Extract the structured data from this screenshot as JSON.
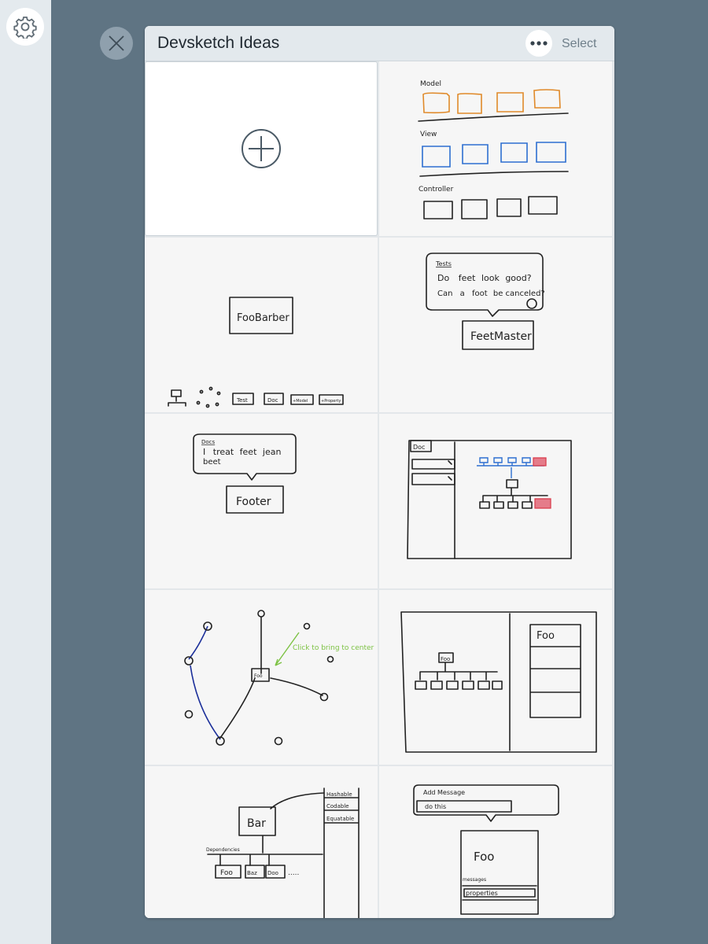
{
  "header": {
    "title": "Devsketch Ideas",
    "select_label": "Select"
  },
  "icons": {
    "settings": "gear-icon",
    "close": "close-icon",
    "more": "more-horizontal-icon",
    "add": "plus-circle-icon"
  },
  "colors": {
    "background": "#5f7483",
    "rail": "#e4eaee",
    "header": "#e3e9ed",
    "accent_blue": "#2d6fd0",
    "accent_orange": "#e08a2a",
    "accent_green": "#7cc243",
    "accent_red": "#d93a4a"
  },
  "sketches": [
    {
      "labels": [
        "Model",
        "View",
        "Controller"
      ]
    },
    {
      "labels": [
        "FooBarber",
        "Test",
        "Doc",
        "+Model",
        "+Property"
      ]
    },
    {
      "labels": [
        "Tests",
        "Do",
        "feet",
        "look",
        "good?",
        "Can",
        "a",
        "foot",
        "be canceled?",
        "FeetMaster"
      ]
    },
    {
      "labels": [
        "Docs",
        "I",
        "treat",
        "feet",
        "jean",
        "beet",
        "Footer"
      ]
    },
    {
      "labels": [
        "Doc"
      ]
    },
    {
      "labels": [
        "Foo",
        "Click to bring to center"
      ]
    },
    {
      "labels": [
        "Foo",
        "Foo"
      ]
    },
    {
      "labels": [
        "Hashable",
        "Codable",
        "Equatable",
        "Bar",
        "Dependencies",
        "Foo",
        "Baz",
        "Doo",
        "....."
      ]
    },
    {
      "labels": [
        "Add Message",
        "do this",
        "Foo",
        "messages",
        "properties"
      ]
    }
  ]
}
